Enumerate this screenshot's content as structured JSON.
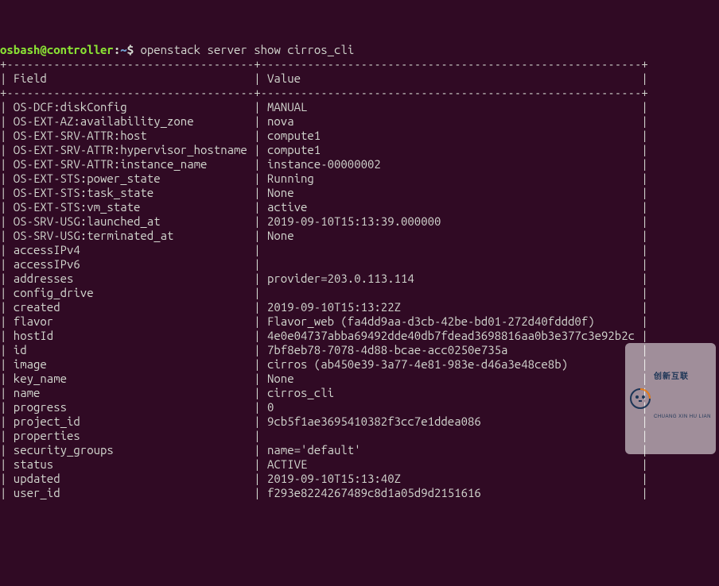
{
  "prompt": {
    "user_host": "osbash@controller",
    "sep1": ":",
    "path": "~",
    "sep2": "$ ",
    "command": "openstack server show cirros_cli"
  },
  "table": {
    "header": {
      "field": "Field",
      "value": "Value"
    },
    "col1_width": 37,
    "col2_width": 57,
    "rows": [
      {
        "field": "OS-DCF:diskConfig",
        "value": "MANUAL"
      },
      {
        "field": "OS-EXT-AZ:availability_zone",
        "value": "nova"
      },
      {
        "field": "OS-EXT-SRV-ATTR:host",
        "value": "compute1"
      },
      {
        "field": "OS-EXT-SRV-ATTR:hypervisor_hostname",
        "value": "compute1"
      },
      {
        "field": "OS-EXT-SRV-ATTR:instance_name",
        "value": "instance-00000002"
      },
      {
        "field": "OS-EXT-STS:power_state",
        "value": "Running"
      },
      {
        "field": "OS-EXT-STS:task_state",
        "value": "None"
      },
      {
        "field": "OS-EXT-STS:vm_state",
        "value": "active"
      },
      {
        "field": "OS-SRV-USG:launched_at",
        "value": "2019-09-10T15:13:39.000000"
      },
      {
        "field": "OS-SRV-USG:terminated_at",
        "value": "None"
      },
      {
        "field": "accessIPv4",
        "value": ""
      },
      {
        "field": "accessIPv6",
        "value": ""
      },
      {
        "field": "addresses",
        "value": "provider=203.0.113.114"
      },
      {
        "field": "config_drive",
        "value": ""
      },
      {
        "field": "created",
        "value": "2019-09-10T15:13:22Z"
      },
      {
        "field": "flavor",
        "value": "Flavor_web (fa4dd9aa-d3cb-42be-bd01-272d40fddd0f)"
      },
      {
        "field": "hostId",
        "value": "4e0e04737abba69492dde40db7fdead3698816aa0b3e377c3e92b2cc"
      },
      {
        "field": "id",
        "value": "7bf8eb78-7078-4d88-bcae-acc0250e735a"
      },
      {
        "field": "image",
        "value": "cirros (ab450e39-3a77-4e81-983e-d46a3e48ce8b)"
      },
      {
        "field": "key_name",
        "value": "None"
      },
      {
        "field": "name",
        "value": "cirros_cli"
      },
      {
        "field": "progress",
        "value": "0"
      },
      {
        "field": "project_id",
        "value": "9cb5f1ae3695410382f3cc7e1ddea086"
      },
      {
        "field": "properties",
        "value": ""
      },
      {
        "field": "security_groups",
        "value": "name='default'"
      },
      {
        "field": "status",
        "value": "ACTIVE"
      },
      {
        "field": "updated",
        "value": "2019-09-10T15:13:40Z"
      },
      {
        "field": "user_id",
        "value": "f293e8224267489c8d1a05d9d2151616"
      }
    ]
  },
  "watermark": {
    "brand_cn": "创新互联",
    "brand_en": "CHUANG XIN HU LIAN"
  }
}
